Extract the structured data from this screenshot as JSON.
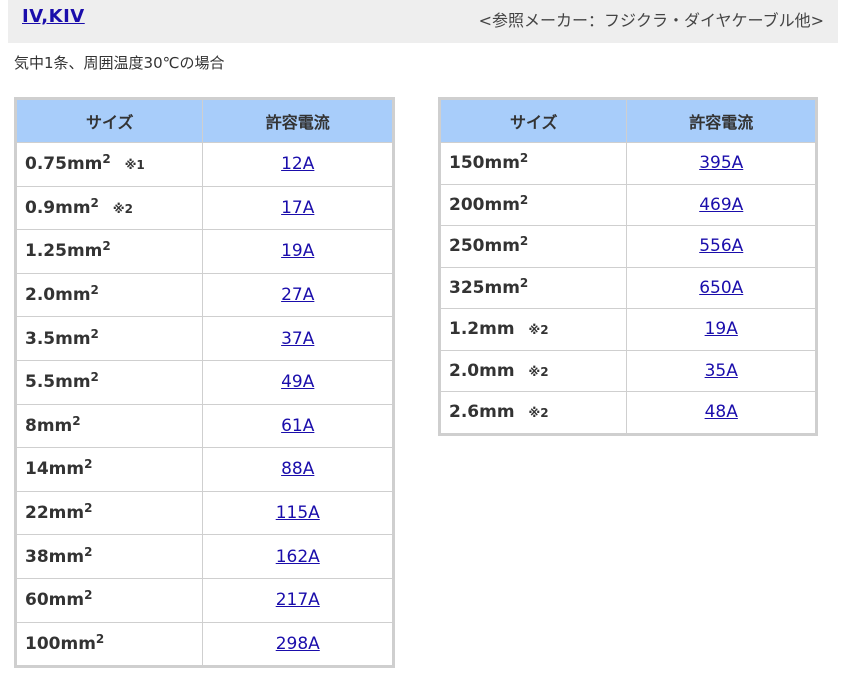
{
  "header": {
    "title": "IV,KIV",
    "reference": "<参照メーカー：フジクラ・ダイヤケーブル他>"
  },
  "condition": "気中1条、周囲温度30℃の場合",
  "columns": {
    "size": "サイズ",
    "current": "許容電流"
  },
  "left_rows": [
    {
      "size": "0.75mm",
      "sup": "2",
      "note": "※1",
      "current": "12A"
    },
    {
      "size": "0.9mm",
      "sup": "2",
      "note": "※2",
      "current": "17A"
    },
    {
      "size": "1.25mm",
      "sup": "2",
      "note": "",
      "current": "19A"
    },
    {
      "size": "2.0mm",
      "sup": "2",
      "note": "",
      "current": "27A"
    },
    {
      "size": "3.5mm",
      "sup": "2",
      "note": "",
      "current": "37A"
    },
    {
      "size": "5.5mm",
      "sup": "2",
      "note": "",
      "current": "49A"
    },
    {
      "size": "8mm",
      "sup": "2",
      "note": "",
      "current": "61A"
    },
    {
      "size": "14mm",
      "sup": "2",
      "note": "",
      "current": "88A"
    },
    {
      "size": "22mm",
      "sup": "2",
      "note": "",
      "current": "115A"
    },
    {
      "size": "38mm",
      "sup": "2",
      "note": "",
      "current": "162A"
    },
    {
      "size": "60mm",
      "sup": "2",
      "note": "",
      "current": "217A"
    },
    {
      "size": "100mm",
      "sup": "2",
      "note": "",
      "current": "298A"
    }
  ],
  "right_rows": [
    {
      "size": "150mm",
      "sup": "2",
      "note": "",
      "current": "395A"
    },
    {
      "size": "200mm",
      "sup": "2",
      "note": "",
      "current": "469A"
    },
    {
      "size": "250mm",
      "sup": "2",
      "note": "",
      "current": "556A"
    },
    {
      "size": "325mm",
      "sup": "2",
      "note": "",
      "current": "650A"
    },
    {
      "size": "1.2mm",
      "sup": "",
      "note": "※2",
      "current": "19A"
    },
    {
      "size": "2.0mm",
      "sup": "",
      "note": "※2",
      "current": "35A"
    },
    {
      "size": "2.6mm",
      "sup": "",
      "note": "※2",
      "current": "48A"
    }
  ]
}
